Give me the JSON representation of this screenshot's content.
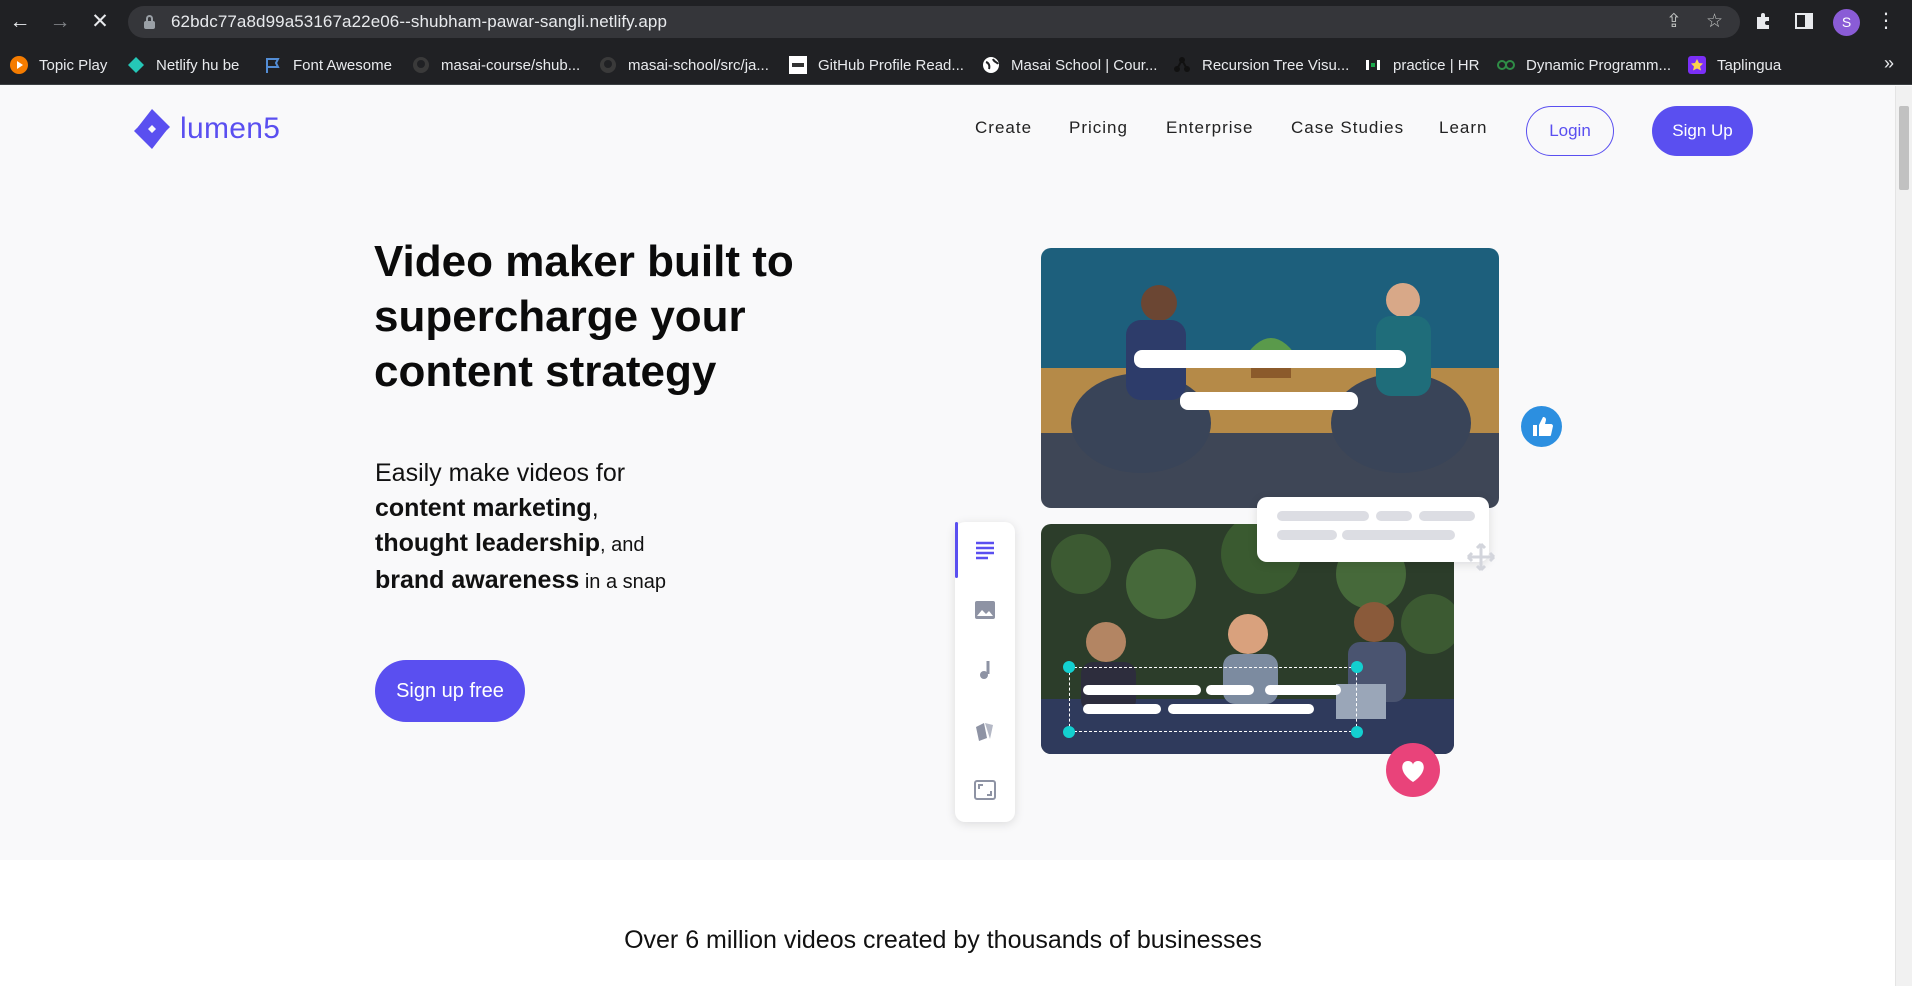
{
  "browser": {
    "url": "62bdc77a8d99a53167a22e06--shubham-pawar-sangli.netlify.app",
    "profile_initial": "S",
    "bookmarks": [
      {
        "label": "Topic Play",
        "icon": "play-circle-icon"
      },
      {
        "label": "Netlify hu be",
        "icon": "netlify-icon"
      },
      {
        "label": "Font Awesome",
        "icon": "flag-icon"
      },
      {
        "label": "masai-course/shub...",
        "icon": "github-icon"
      },
      {
        "label": "masai-school/src/ja...",
        "icon": "github-icon"
      },
      {
        "label": "GitHub Profile Read...",
        "icon": "readme-icon"
      },
      {
        "label": "Masai School | Cour...",
        "icon": "globe-icon"
      },
      {
        "label": "Recursion Tree Visu...",
        "icon": "tree-icon"
      },
      {
        "label": "practice | HR",
        "icon": "hackerrank-icon"
      },
      {
        "label": "Dynamic Programm...",
        "icon": "gfg-icon"
      },
      {
        "label": "Taplingua",
        "icon": "star-icon"
      }
    ],
    "bookmarks_more": "»"
  },
  "site": {
    "logo_text": "lumen5",
    "nav": [
      "Create",
      "Pricing",
      "Enterprise",
      "Case Studies",
      "Learn"
    ],
    "login_label": "Login",
    "signup_label": "Sign Up"
  },
  "hero": {
    "title": "Video maker built to supercharge your content strategy",
    "sub_line1": "Easily make videos for",
    "sub_b1": "content marketing",
    "sub_comma": ",",
    "sub_b2": "thought leadership",
    "sub_and": ", and",
    "sub_b3": "brand awareness",
    "sub_end": " in a snap",
    "cta": "Sign up free"
  },
  "stats": {
    "line": "Over 6 million videos created by thousands of businesses"
  },
  "colors": {
    "brand": "#5a4ff0",
    "chrome": "#202124",
    "like": "#2c8fe0",
    "heart": "#e9437a"
  }
}
